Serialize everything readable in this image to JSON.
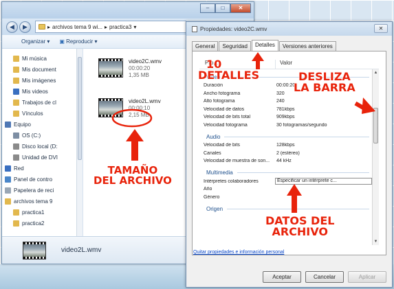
{
  "explorer": {
    "window_buttons": [
      "–",
      "□",
      "✕"
    ],
    "nav_back": "◀",
    "nav_forward": "▶",
    "breadcrumb": [
      "archivos tema 9 wi...",
      "practica3"
    ],
    "toolbar": {
      "organize": "Organizar ▾",
      "play": "Reproducir ▾"
    },
    "nav_items": [
      {
        "label": "Mi música",
        "icon": "music-folder-icon",
        "color": "#e2b84d"
      },
      {
        "label": "Mis document",
        "icon": "documents-folder-icon",
        "color": "#e2b84d"
      },
      {
        "label": "Mis imágenes",
        "icon": "pictures-folder-icon",
        "color": "#e2b84d"
      },
      {
        "label": "Mis videos",
        "icon": "videos-folder-icon",
        "color": "#3a6fc0"
      },
      {
        "label": "Trabajos de cl",
        "icon": "folder-icon",
        "color": "#e2b84d"
      },
      {
        "label": "Vínculos",
        "icon": "links-folder-icon",
        "color": "#e2b84d"
      },
      {
        "label": "Equipo",
        "icon": "computer-icon",
        "color": "#4f78b5"
      },
      {
        "label": "OS (C:)",
        "icon": "drive-icon",
        "color": "#7d8ea3"
      },
      {
        "label": "Disco local (D:",
        "icon": "drive-icon",
        "color": "#8a8a8a"
      },
      {
        "label": "Unidad de DVI",
        "icon": "dvd-drive-icon",
        "color": "#8a8a8a"
      },
      {
        "label": "Red",
        "icon": "network-icon",
        "color": "#3a6fc0"
      },
      {
        "label": "Panel de contro",
        "icon": "control-panel-icon",
        "color": "#4a86c9"
      },
      {
        "label": "Papelera de reci",
        "icon": "recycle-bin-icon",
        "color": "#9aa7b5"
      },
      {
        "label": "archivos tema 9",
        "icon": "folder-icon",
        "color": "#e2b84d"
      },
      {
        "label": "practica1",
        "icon": "folder-icon",
        "color": "#e2b84d"
      },
      {
        "label": "practica2",
        "icon": "folder-icon",
        "color": "#e2b84d"
      }
    ],
    "files": [
      {
        "name": "video2C.wmv",
        "duration": "00:00:20",
        "size": "1,35 MB"
      },
      {
        "name": "video2L.wmv",
        "duration": "00:00:10",
        "size": "2,15 MB"
      }
    ],
    "details_name": "video2L.wmv"
  },
  "props": {
    "title": "Propiedades: video2C.wmv",
    "close": "✕",
    "tabs": [
      "General",
      "Seguridad",
      "Detalles",
      "Versiones anteriores"
    ],
    "active_tab": "Detalles",
    "header": {
      "prop": "Pro...",
      "value": "Valor"
    },
    "sections": [
      {
        "title": "Video",
        "rows": [
          {
            "k": "Duración",
            "v": "00:00:20"
          },
          {
            "k": "Ancho fotograma",
            "v": "320"
          },
          {
            "k": "Alto fotograma",
            "v": "240"
          },
          {
            "k": "Velocidad de datos",
            "v": "781kbps"
          },
          {
            "k": "Velocidad de bits total",
            "v": "909kbps"
          },
          {
            "k": "Velocidad fotograma",
            "v": "30 fotogramas/segundo"
          }
        ]
      },
      {
        "title": "Audio",
        "rows": [
          {
            "k": "Velocidad de bits",
            "v": "128kbps"
          },
          {
            "k": "Canales",
            "v": "2 (estéreo)"
          },
          {
            "k": "Velocidad de muestra de son...",
            "v": "44 kHz"
          }
        ]
      },
      {
        "title": "Multimedia",
        "rows": [
          {
            "k": "Intérpretes colaboradores",
            "v": "Especificar un intérprete c...",
            "box": true
          },
          {
            "k": "Año",
            "v": ""
          },
          {
            "k": "Género",
            "v": ""
          }
        ]
      },
      {
        "title": "Origen",
        "rows": []
      }
    ],
    "link": "Quitar propiedades e información personal",
    "buttons": {
      "ok": "Aceptar",
      "cancel": "Cancelar",
      "apply": "Aplicar"
    }
  },
  "annotations": {
    "tamano_line1": "TAMAÑO",
    "tamano_line2": "DEL ARCHIVO",
    "detalles_num": "10",
    "detalles_word": "DETALLES",
    "desliza_line1": "DESLIZA",
    "desliza_line2": "LA BARRA",
    "datos_line1": "DATOS DEL",
    "datos_line2": "ARCHIVO",
    "color": "#e8230b"
  }
}
